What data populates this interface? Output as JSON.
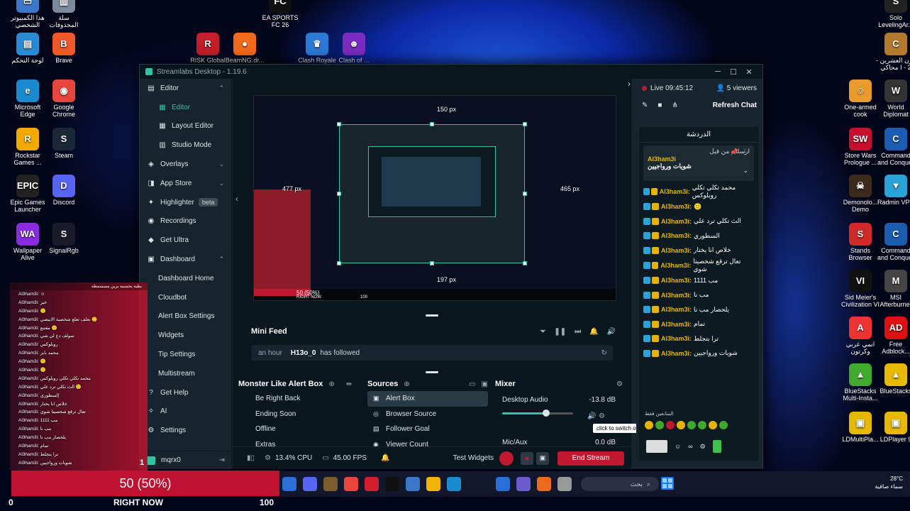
{
  "desktop": {
    "icons_left": [
      {
        "label": "هذا الكمبيوتر الشخصي",
        "color": "#3b77c9",
        "glyph": "▭"
      },
      {
        "label": "سلة المحذوفات",
        "color": "#7c8aa0",
        "glyph": "▥"
      },
      {
        "label": "لوحة التحكم",
        "color": "#2a8bd4",
        "glyph": "▤"
      },
      {
        "label": "Brave",
        "color": "#f0582a",
        "glyph": "B"
      },
      {
        "label": "Microsoft Edge",
        "color": "#1a8bd0",
        "glyph": "e"
      },
      {
        "label": "Google Chrome",
        "color": "#e8453c",
        "glyph": "◉"
      },
      {
        "label": "Rockstar Games ...",
        "color": "#f2a900",
        "glyph": "R"
      },
      {
        "label": "Steam",
        "color": "#1b2838",
        "glyph": "S"
      },
      {
        "label": "Epic Games Launcher",
        "color": "#222",
        "glyph": "EPIC"
      },
      {
        "label": "Discord",
        "color": "#5865f2",
        "glyph": "D"
      },
      {
        "label": "Wallpaper Alive",
        "color": "#8a2be2",
        "glyph": "WA"
      },
      {
        "label": "SignalRgb",
        "color": "#1a1a2a",
        "glyph": "S"
      }
    ],
    "icons_top": [
      {
        "label": "EA SPORTS FC 26",
        "color": "#111",
        "glyph": "FC"
      },
      {
        "label": "RISK Global ...",
        "color": "#c41e2a",
        "glyph": "R"
      },
      {
        "label": "BeamNG.dr...",
        "color": "#f26b1d",
        "glyph": "●"
      },
      {
        "label": "Clash Royale",
        "color": "#2a7bd8",
        "glyph": "♛"
      },
      {
        "label": "Clash of ...",
        "color": "#7a2bc0",
        "glyph": "☻"
      }
    ],
    "icons_right": [
      {
        "label": "Solo LevelingAr...",
        "color": "#222",
        "glyph": "S"
      },
      {
        "label": "قرن العشرين - محاكي I - 2",
        "color": "#b37a2e",
        "glyph": "C"
      },
      {
        "label": "One-armed cook",
        "color": "#e89a2c",
        "glyph": "☺"
      },
      {
        "label": "World Diplomat",
        "color": "#333",
        "glyph": "W"
      },
      {
        "label": "Store Wars Prologue ...",
        "color": "#c8102e",
        "glyph": "SW"
      },
      {
        "label": "Command and Conquer",
        "color": "#1a5cb0",
        "glyph": "C"
      },
      {
        "label": "Demonolo... Demo",
        "color": "#3a2a1a",
        "glyph": "☠"
      },
      {
        "label": "Radmin VPN",
        "color": "#2aa3d6",
        "glyph": "▼"
      },
      {
        "label": "Stands Browser",
        "color": "#d12a2a",
        "glyph": "S"
      },
      {
        "label": "Command and Conquer",
        "color": "#1a5cb0",
        "glyph": "C"
      },
      {
        "label": "Sid Meier's Civilization VI",
        "color": "#111",
        "glyph": "VI"
      },
      {
        "label": "MSI Afterburner",
        "color": "#444",
        "glyph": "M"
      },
      {
        "label": "انمي عربي وكرتون",
        "color": "#e33",
        "glyph": "A"
      },
      {
        "label": "Free Adblock...",
        "color": "#d11",
        "glyph": "AD"
      },
      {
        "label": "BlueStacks Multi-Insta...",
        "color": "#3fa92e",
        "glyph": "▲"
      },
      {
        "label": "BlueStacks",
        "color": "#e6b800",
        "glyph": "▲"
      },
      {
        "label": "LDMultiPla...",
        "color": "#e6b800",
        "glyph": "▣"
      },
      {
        "label": "LDPlayer 9",
        "color": "#e6b800",
        "glyph": "▣"
      }
    ]
  },
  "app": {
    "title": "Streamlabs Desktop - 1.19.6",
    "window_buttons": [
      "─",
      "☐",
      "✕"
    ],
    "nav": [
      {
        "label": "Editor",
        "icon": "▤",
        "type": "group",
        "chev": "⌃"
      },
      {
        "label": "Editor",
        "icon": "▦",
        "type": "sub active"
      },
      {
        "label": "Layout Editor",
        "icon": "▦",
        "type": "sub"
      },
      {
        "label": "Studio Mode",
        "icon": "▥",
        "type": "sub"
      },
      {
        "label": "Overlays",
        "icon": "◈",
        "type": "group",
        "chev": "⌄"
      },
      {
        "label": "App Store",
        "icon": "◨",
        "type": "group",
        "chev": "⌄"
      },
      {
        "label": "Highlighter",
        "icon": "✦",
        "type": "group",
        "badge": "beta"
      },
      {
        "label": "Recordings",
        "icon": "◉",
        "type": "group"
      },
      {
        "label": "Get Ultra",
        "icon": "◆",
        "type": "group"
      },
      {
        "label": "Dashboard",
        "icon": "▣",
        "type": "group",
        "chev": "⌃"
      },
      {
        "label": "Dashboard Home",
        "icon": "",
        "type": "sub"
      },
      {
        "label": "Cloudbot",
        "icon": "",
        "type": "sub"
      },
      {
        "label": "Alert Box Settings",
        "icon": "",
        "type": "sub"
      },
      {
        "label": "Widgets",
        "icon": "",
        "type": "sub"
      },
      {
        "label": "Tip Settings",
        "icon": "",
        "type": "sub"
      },
      {
        "label": "Multistream",
        "icon": "",
        "type": "sub"
      },
      {
        "label": "Get Help",
        "icon": "?",
        "type": "group"
      },
      {
        "label": "AI",
        "icon": "✧",
        "type": "group"
      },
      {
        "label": "Settings",
        "icon": "⚙",
        "type": "group"
      }
    ],
    "user": {
      "name": "mqrx0",
      "logout": "⇥"
    },
    "preview": {
      "label_top": "150 px",
      "label_left": "477 px",
      "label_right": "465 px",
      "label_bottom": "197 px",
      "goal": "50 (50%)",
      "right_now": "RIGHT NOW",
      "max": "100"
    },
    "minifeed": {
      "title": "Mini Feed",
      "controls": [
        "⏷",
        "❚❚",
        "⏭",
        "🔔",
        "🔊"
      ],
      "row": {
        "time": "an hour",
        "user": "H13o_0",
        "action": "has followed",
        "refresh": "↻"
      }
    },
    "scenes": {
      "title": "Monster Like Alert Box",
      "items": [
        "Be Right Back",
        "Ending Soon",
        "Offline",
        "Extras"
      ]
    },
    "sources": {
      "title": "Sources",
      "items": [
        {
          "label": "Alert Box",
          "icon": "▣",
          "selected": true
        },
        {
          "label": "Browser Source",
          "icon": "◎",
          "selected": false
        },
        {
          "label": "Follower Goal",
          "icon": "▤",
          "selected": false
        },
        {
          "label": "Viewer Count",
          "icon": "◉",
          "selected": false
        }
      ]
    },
    "mixer": {
      "title": "Mixer",
      "channels": [
        {
          "name": "Desktop Audio",
          "db": "-13.8 dB",
          "level": 0.62
        },
        {
          "name": "Mic/Aux",
          "db": "0.0 dB"
        }
      ],
      "tooltip": "click to switch off"
    },
    "footer": {
      "cpu": "13.4% CPU",
      "fps": "45.00 FPS",
      "test_widgets": "Test Widgets",
      "end_stream": "End Stream"
    },
    "chat": {
      "live": "Live 09:45:12",
      "viewers": "5 viewers",
      "refresh": "Refresh Chat",
      "header": "الدردشة",
      "pinned_by": "ارسلت من قبل",
      "pinned_user": "Al3ham3i",
      "pinned_text": "شويات ورواجيين",
      "messages": [
        {
          "user": "Al3ham3i:",
          "text": "محمد تكلي تكلي روبلوكس"
        },
        {
          "user": "Al3ham3i:",
          "text": "🙂"
        },
        {
          "user": "Al3ham3i:",
          "text": "الث تكلي ترد علي"
        },
        {
          "user": "Al3ham3i:",
          "text": "السطوري"
        },
        {
          "user": "Al3ham3i:",
          "text": "خلاص انا يختار"
        },
        {
          "user": "Al3ham3i:",
          "text": "تعال ترقع شخصيتا شوي"
        },
        {
          "user": "Al3ham3i:",
          "text": "مب 1111"
        },
        {
          "user": "Al3ham3i:",
          "text": "مب نا"
        },
        {
          "user": "Al3ham3i:",
          "text": "يلحصار مب نا"
        },
        {
          "user": "Al3ham3i:",
          "text": "تمام"
        },
        {
          "user": "Al3ham3i:",
          "text": "ترا بتجلط"
        },
        {
          "user": "Al3ham3i:",
          "text": "شويات ورواجيين"
        }
      ],
      "input_label": "المتابعين فقط"
    }
  },
  "overlay": {
    "alert_header": "بطيه يحسنيه يرين مسسمطه",
    "alert_messages": [
      "Al3ham3i: ☺",
      "Al3ham3i: خير",
      "Al3ham3i: 🙂",
      "Al3ham3i: نعلف تعلع شخصية الابيضي 🙂",
      "Al3ham3i: مقتنع 🙂",
      "Al3ham3i: سولف دع لي شي",
      "Al3ham3i: روبلوكس",
      "Al3ham3i: محمد بايز",
      "Al3ham3i: 🙂",
      "Al3ham3i: 🙂",
      "Al3ham3i: محمد تكلي تكلي روبلوكس",
      "Al3ham3i: الث تكلي ترد علي 🙂",
      "Al3ham3i: إلسطوري",
      "Al3ham3i: خلاص انا يختار",
      "Al3ham3i: تعال ترقع شخصيتا شوي",
      "Al3ham3i: مب 1111",
      "Al3ham3i: مب نا",
      "Al3ham3i: يلحصار مب نا",
      "Al3ham3i: تمام",
      "Al3ham3i: ترا بتجلط",
      "Al3ham3i: شويات ورواجيين"
    ],
    "goal_text": "50 (50%)",
    "goal_fraction": 0.5,
    "label_min": "0",
    "label_right_now": "RIGHT NOW",
    "label_max": "100",
    "side_number": "1"
  },
  "taskbar": {
    "search_placeholder": "بحث",
    "weather_temp": "28°C",
    "weather_desc": "سماء صافية",
    "apps": [
      "#2a6ed8",
      "#5865f2",
      "#7a5c2e",
      "#e8453c",
      "#d21f2f",
      "#111",
      "#3b77c9",
      "#f2b400",
      "#1a8bd0",
      "#2a6ed8",
      "#6a5acd",
      "#e86a1d",
      "#999"
    ]
  },
  "colors": {
    "accent": "#31c3a2",
    "live": "#c0182e",
    "goal": "#bf1230"
  }
}
